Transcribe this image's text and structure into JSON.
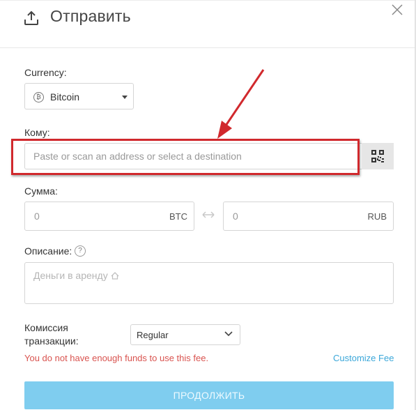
{
  "header": {
    "title": "Отправить",
    "icon": "upload-icon"
  },
  "currency": {
    "label": "Currency:",
    "selected": "Bitcoin",
    "icon": "bitcoin-icon"
  },
  "recipient": {
    "label": "Кому:",
    "placeholder": "Paste or scan an address or select a destination",
    "qr_icon": "qr-code-icon"
  },
  "amount": {
    "label": "Сумма:",
    "crypto_value": "0",
    "crypto_unit": "BTC",
    "fiat_value": "0",
    "fiat_unit": "RUB"
  },
  "description": {
    "label": "Описание:",
    "help": "?",
    "placeholder": "Деньги в аренду"
  },
  "fee": {
    "label": "Комиссия транзакции:",
    "selected": "Regular"
  },
  "error_text": "You do not have enough funds to use this fee.",
  "customize_fee": "Customize Fee",
  "continue_label": "ПРОДОЛЖИТЬ",
  "colors": {
    "accent": "#7fcdef",
    "link": "#3ba7d9",
    "error": "#d9534f",
    "annotation": "#d1292d"
  }
}
